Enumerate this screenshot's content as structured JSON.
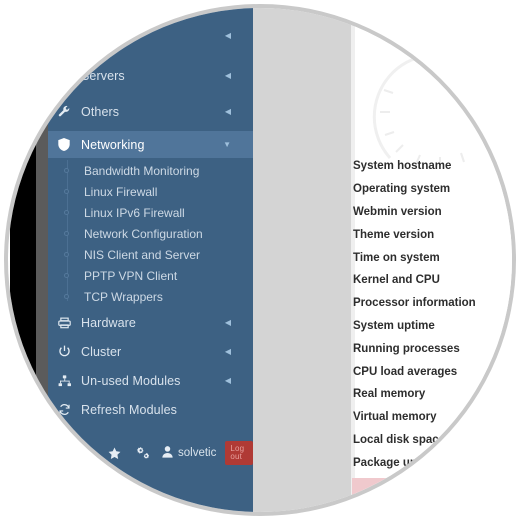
{
  "colors": {
    "sidebar_bg": "#3d6183",
    "sidebar_active_bg": "#50759a",
    "spacer_panel": "#d4d4d4",
    "circle_border": "#c9c9c9",
    "content_text": "#2d2d2d",
    "logout_bg": "#b03a35",
    "pink_block": "#f0c9cd"
  },
  "sidebar": {
    "top_clipped_items": [
      {
        "label": "",
        "icon": "blank-icon",
        "caret": "caret-left-icon"
      },
      {
        "label": "Servers",
        "icon": "servers-icon",
        "caret": "caret-left-icon"
      }
    ],
    "items": [
      {
        "label": "Others",
        "icon": "wrench-icon",
        "caret": "caret-left-icon",
        "active": false
      },
      {
        "label": "Networking",
        "icon": "shield-icon",
        "caret": "caret-down-icon",
        "active": true
      },
      {
        "label": "Hardware",
        "icon": "printer-icon",
        "caret": "caret-left-icon",
        "active": false
      },
      {
        "label": "Cluster",
        "icon": "power-icon",
        "caret": "caret-left-icon",
        "active": false
      },
      {
        "label": "Un-used Modules",
        "icon": "sitemap-icon",
        "caret": "caret-left-icon",
        "active": false
      },
      {
        "label": "Refresh Modules",
        "icon": "refresh-icon",
        "caret": "",
        "active": false
      }
    ],
    "networking_submenu": [
      {
        "label": "Bandwidth Monitoring"
      },
      {
        "label": "Linux Firewall"
      },
      {
        "label": "Linux IPv6 Firewall"
      },
      {
        "label": "Network Configuration"
      },
      {
        "label": "NIS Client and Server"
      },
      {
        "label": "PPTP VPN Client"
      },
      {
        "label": "TCP Wrappers"
      }
    ],
    "toolbar": {
      "favorites_icon": "star-icon",
      "settings_icon": "gears-icon",
      "user_icon": "user-icon",
      "username": "solvetic",
      "logout_label": "Log out"
    }
  },
  "main": {
    "info_rows": [
      {
        "label": "System hostname"
      },
      {
        "label": "Operating system"
      },
      {
        "label": "Webmin version"
      },
      {
        "label": "Theme version"
      },
      {
        "label": "Time on system"
      },
      {
        "label": "Kernel and CPU"
      },
      {
        "label": "Processor information"
      },
      {
        "label": "System uptime"
      },
      {
        "label": "Running processes"
      },
      {
        "label": "CPU load averages"
      },
      {
        "label": "Real memory"
      },
      {
        "label": "Virtual memory"
      },
      {
        "label": "Local disk space"
      },
      {
        "label": "Package updates"
      }
    ]
  }
}
